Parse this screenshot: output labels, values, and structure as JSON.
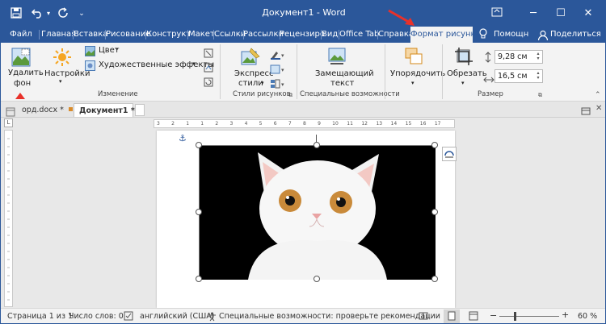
{
  "window": {
    "title": "Документ1 - Word",
    "brand_color": "#2b579a"
  },
  "titlebar": {
    "save_icon": "save-icon",
    "undo_icon": "undo-icon",
    "redo_icon": "redo-icon",
    "qat_icon": "customize-icon"
  },
  "tabs": [
    "Файл",
    "Главная",
    "Вставка",
    "Рисование",
    "Конструкт",
    "Макет",
    "Ссылки",
    "Рассылки",
    "Рецензиро",
    "Вид",
    "Office Tab",
    "Справка",
    "Формат рисунка",
    "Помощн",
    "Поделиться"
  ],
  "ribbon": {
    "remove_bg_line1": "Удалить",
    "remove_bg_line2": "фон",
    "corrections": "Настройки",
    "color": "Цвет",
    "artistic": "Художественные эффекты",
    "group_adjust": "Изменение",
    "quick_styles_line1": "Экспресс-",
    "quick_styles_line2": "стили",
    "group_styles": "Стили рисунков",
    "alt_text_line1": "Замещающий",
    "alt_text_line2": "текст",
    "group_access": "Специальные возможности",
    "arrange": "Упорядочить",
    "crop": "Обрезать",
    "height": "9,28 см",
    "width": "16,5 см",
    "group_size": "Размер"
  },
  "doc_tabs": [
    {
      "label": "орд.docx *"
    },
    {
      "label": "Документ1 *"
    }
  ],
  "ruler_numbers": [
    "3",
    "2",
    "1",
    "1",
    "2",
    "3",
    "4",
    "5",
    "6",
    "7",
    "8",
    "9",
    "10",
    "11",
    "12",
    "13",
    "14",
    "15",
    "16",
    "17"
  ],
  "statusbar": {
    "page": "Страница 1 из 1",
    "words": "Число слов: 0",
    "lang": "английский (США)",
    "accessibility": "Специальные возможности: проверьте рекомендации",
    "zoom": "60 %"
  }
}
